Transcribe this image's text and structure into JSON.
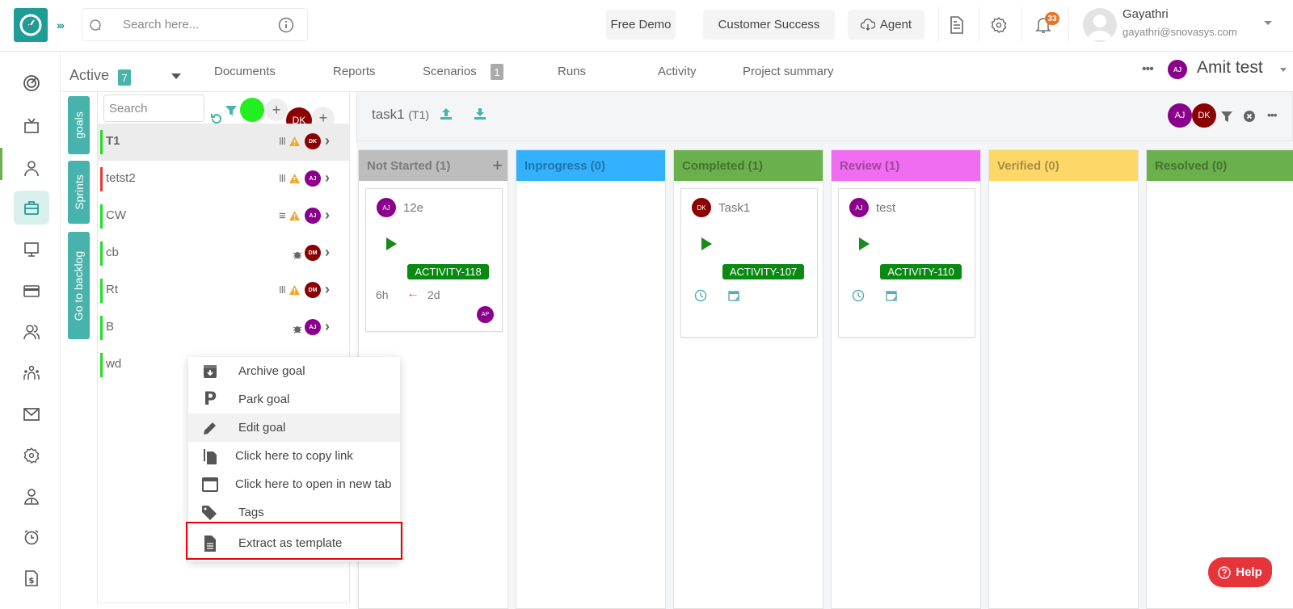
{
  "topbar": {
    "search_placeholder": "Search here...",
    "buttons": {
      "free_demo": "Free Demo",
      "customer_success": "Customer Success",
      "agent": "Agent"
    },
    "notification_count": "33",
    "user": {
      "name": "Gayathri",
      "email": "gayathri@snovasys.com"
    }
  },
  "sidebar": {
    "items": [
      {
        "name": "dashboard",
        "icon": "radar-icon"
      },
      {
        "name": "tv",
        "icon": "tv-icon"
      },
      {
        "name": "user",
        "icon": "user-icon"
      },
      {
        "name": "projects",
        "icon": "briefcase-icon",
        "active": true
      },
      {
        "name": "monitor",
        "icon": "monitor-icon"
      },
      {
        "name": "billing",
        "icon": "card-icon"
      },
      {
        "name": "users",
        "icon": "users-icon"
      },
      {
        "name": "team",
        "icon": "team-icon"
      },
      {
        "name": "mail",
        "icon": "mail-icon"
      },
      {
        "name": "settings",
        "icon": "gear-icon"
      },
      {
        "name": "profile",
        "icon": "employee-icon"
      },
      {
        "name": "timer",
        "icon": "alarm-icon"
      },
      {
        "name": "invoice",
        "icon": "invoice-icon"
      }
    ]
  },
  "tabs": {
    "active_label": "Active",
    "active_count": "7",
    "items": [
      "Documents",
      "Reports",
      "Scenarios",
      "Runs",
      "Activity",
      "Project summary"
    ],
    "scenarios_count": "1",
    "project_name": "Amit test",
    "project_avatar": "AJ"
  },
  "goals_panel": {
    "side_tabs": [
      "goals",
      "Sprints",
      "Go to backlog"
    ],
    "search_placeholder": "Search",
    "filter_avatar": "DK",
    "goals": [
      {
        "name": "T1",
        "bar_color": "#22dd22",
        "icons": "III",
        "warn": true,
        "avatar": "DK",
        "avatar_color": "#8b0000",
        "selected": true
      },
      {
        "name": "tetst2",
        "bar_color": "#e53935",
        "icons": "III",
        "warn": true,
        "avatar": "AJ",
        "avatar_color": "#8b008b"
      },
      {
        "name": "CW",
        "bar_color": "#22dd22",
        "icons": "≡",
        "warn": true,
        "avatar": "AJ",
        "avatar_color": "#8b008b"
      },
      {
        "name": "cb",
        "bar_color": "#22dd22",
        "icons": "bug",
        "warn": false,
        "avatar": "DM",
        "avatar_color": "#8b0000"
      },
      {
        "name": "Rt",
        "bar_color": "#22dd22",
        "icons": "III",
        "warn": true,
        "avatar": "DM",
        "avatar_color": "#8b0000"
      },
      {
        "name": "B",
        "bar_color": "#22dd22",
        "icons": "bug",
        "warn": false,
        "avatar": "AJ",
        "avatar_color": "#8b008b"
      },
      {
        "name": "wd",
        "bar_color": "#22dd22",
        "icons": "",
        "warn": false,
        "avatar": "",
        "avatar_color": ""
      }
    ]
  },
  "context_menu": {
    "items": [
      {
        "label": "Archive goal",
        "icon": "archive-icon"
      },
      {
        "label": "Park goal",
        "icon": "park-icon"
      },
      {
        "label": "Edit goal",
        "icon": "pencil-icon"
      },
      {
        "label": "Click here to copy link",
        "icon": "copy-icon"
      },
      {
        "label": "Click here to open in new tab",
        "icon": "window-icon"
      },
      {
        "label": "Tags",
        "icon": "tag-icon"
      },
      {
        "label": "Extract as template",
        "icon": "document-icon"
      }
    ]
  },
  "board": {
    "title": "task1",
    "code": "(T1)",
    "header_avatars": [
      {
        "initials": "AJ",
        "color": "#8b008b"
      },
      {
        "initials": "DK",
        "color": "#8b0000"
      }
    ],
    "columns": [
      {
        "title": "Not Started (1)",
        "color": "#bdbdbd",
        "cards": [
          {
            "avatar": "AJ",
            "avatar_color": "#8b008b",
            "title": "12e",
            "tag": "ACTIVITY-118",
            "estimate": "6h",
            "deadline": "2d",
            "assignee": "AP"
          }
        ]
      },
      {
        "title": "Inprogress (0)",
        "color": "#33b1ff",
        "cards": []
      },
      {
        "title": "Completed (1)",
        "color": "#6ab04c",
        "cards": [
          {
            "avatar": "DK",
            "avatar_color": "#8b0000",
            "title": "Task1",
            "tag": "ACTIVITY-107"
          }
        ]
      },
      {
        "title": "Review (1)",
        "color": "#f06cf0",
        "cards": [
          {
            "avatar": "AJ",
            "avatar_color": "#8b008b",
            "title": "test",
            "tag": "ACTIVITY-110"
          }
        ]
      },
      {
        "title": "Verified (0)",
        "color": "#fdd868",
        "cards": []
      },
      {
        "title": "Resolved (0)",
        "color": "#6ab04c",
        "cards": []
      }
    ]
  },
  "help_label": "Help"
}
